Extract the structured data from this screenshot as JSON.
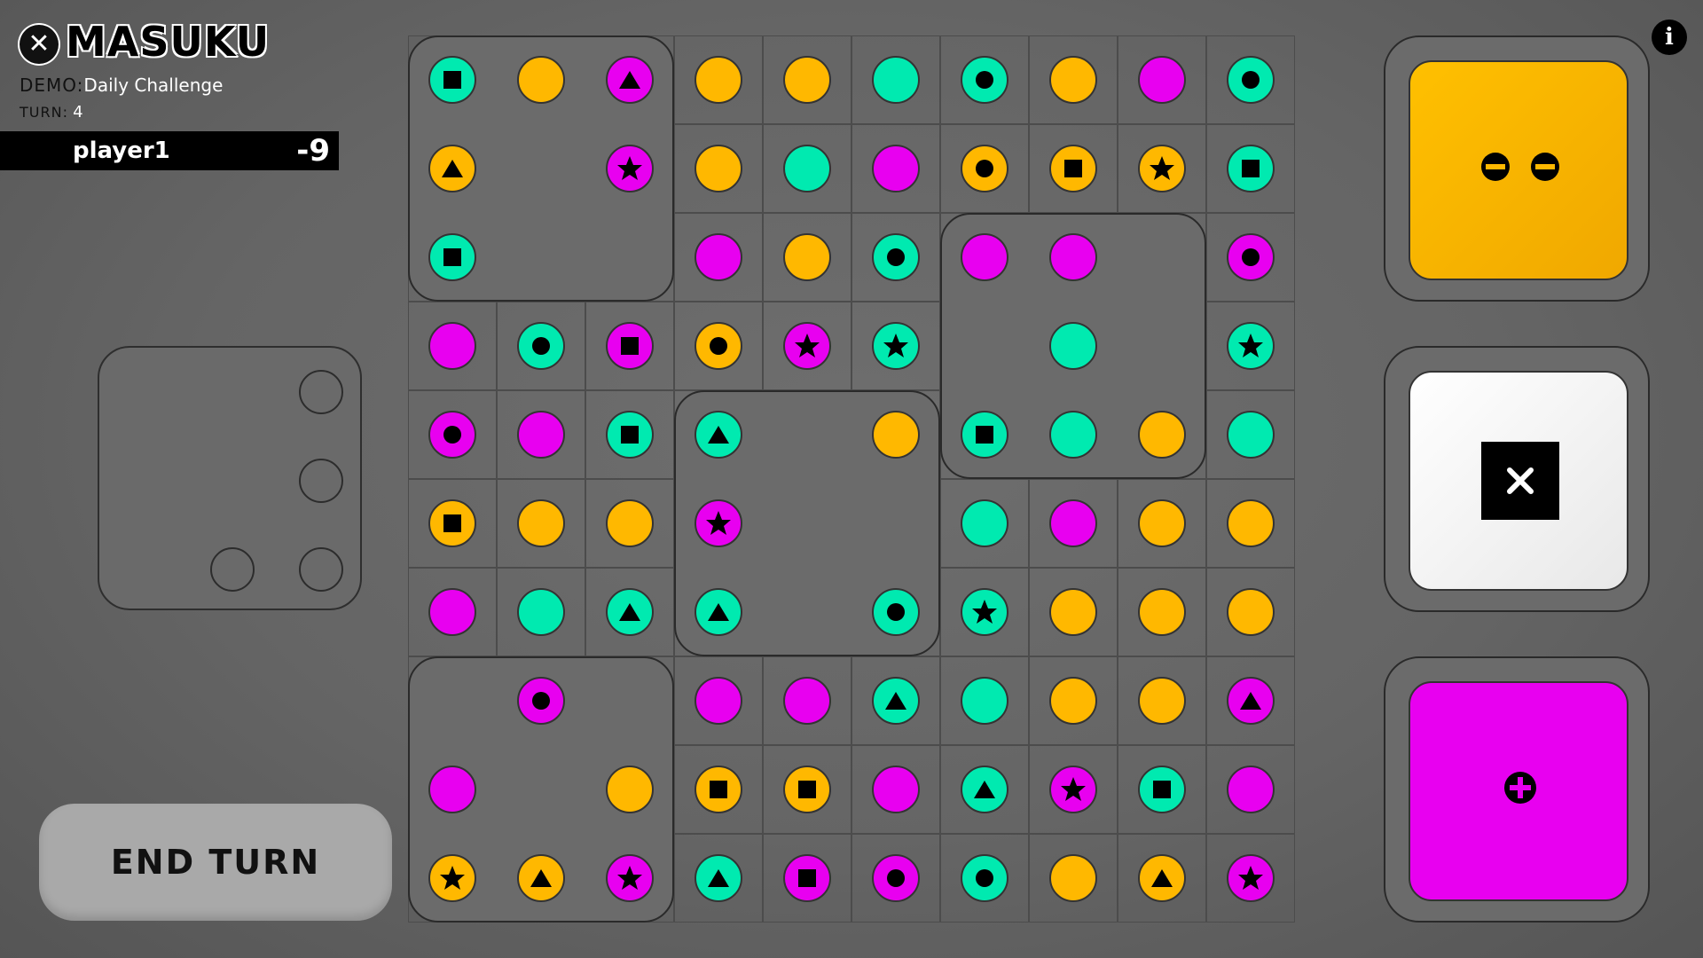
{
  "header": {
    "close_icon": "close-icon",
    "logo_text": "MASUKU",
    "mode_label": "DEMO:",
    "mode_value": "Daily Challenge",
    "turn_label": "TURN:",
    "turn_value": "4"
  },
  "player": {
    "name": "player1",
    "score": "-9"
  },
  "end_turn_label": "END TURN",
  "info_icon": "info-icon",
  "colors": {
    "orange": "#FFB800",
    "teal": "#00EAB0",
    "magenta": "#E800F0",
    "empty": "#6b6b6b"
  },
  "side_panel": {
    "pips": [
      {
        "row": 0,
        "col": 2
      },
      {
        "row": 1,
        "col": 2
      },
      {
        "row": 2,
        "col": 1
      },
      {
        "row": 2,
        "col": 2
      }
    ]
  },
  "dice": [
    {
      "color": "orange",
      "symbol": "minus-minus"
    },
    {
      "color": "white",
      "symbol": "times"
    },
    {
      "color": "magenta",
      "symbol": "plus"
    }
  ],
  "board": {
    "size": 10,
    "pieces": [
      {
        "row": 0,
        "col": 0,
        "w": 3,
        "h": 3
      },
      {
        "row": 2,
        "col": 6,
        "w": 3,
        "h": 3
      },
      {
        "row": 4,
        "col": 3,
        "w": 3,
        "h": 3
      },
      {
        "row": 7,
        "col": 0,
        "w": 3,
        "h": 3
      }
    ],
    "tokens": [
      {
        "r": 0,
        "c": 0,
        "color": "teal",
        "shape": "square"
      },
      {
        "r": 0,
        "c": 1,
        "color": "orange",
        "shape": "none"
      },
      {
        "r": 0,
        "c": 2,
        "color": "magenta",
        "shape": "triangle"
      },
      {
        "r": 0,
        "c": 3,
        "color": "orange",
        "shape": "none"
      },
      {
        "r": 0,
        "c": 4,
        "color": "orange",
        "shape": "none"
      },
      {
        "r": 0,
        "c": 5,
        "color": "teal",
        "shape": "none"
      },
      {
        "r": 0,
        "c": 6,
        "color": "teal",
        "shape": "dot"
      },
      {
        "r": 0,
        "c": 7,
        "color": "orange",
        "shape": "none"
      },
      {
        "r": 0,
        "c": 8,
        "color": "magenta",
        "shape": "none"
      },
      {
        "r": 0,
        "c": 9,
        "color": "teal",
        "shape": "dot"
      },
      {
        "r": 1,
        "c": 0,
        "color": "orange",
        "shape": "triangle"
      },
      {
        "r": 1,
        "c": 2,
        "color": "magenta",
        "shape": "star"
      },
      {
        "r": 1,
        "c": 3,
        "color": "orange",
        "shape": "none"
      },
      {
        "r": 1,
        "c": 4,
        "color": "teal",
        "shape": "none"
      },
      {
        "r": 1,
        "c": 5,
        "color": "magenta",
        "shape": "none"
      },
      {
        "r": 1,
        "c": 6,
        "color": "orange",
        "shape": "dot"
      },
      {
        "r": 1,
        "c": 7,
        "color": "orange",
        "shape": "square"
      },
      {
        "r": 1,
        "c": 8,
        "color": "orange",
        "shape": "star"
      },
      {
        "r": 1,
        "c": 9,
        "color": "teal",
        "shape": "square"
      },
      {
        "r": 2,
        "c": 0,
        "color": "teal",
        "shape": "square"
      },
      {
        "r": 2,
        "c": 3,
        "color": "magenta",
        "shape": "none"
      },
      {
        "r": 2,
        "c": 4,
        "color": "orange",
        "shape": "none"
      },
      {
        "r": 2,
        "c": 5,
        "color": "teal",
        "shape": "dot"
      },
      {
        "r": 2,
        "c": 6,
        "color": "magenta",
        "shape": "none"
      },
      {
        "r": 2,
        "c": 7,
        "color": "magenta",
        "shape": "none"
      },
      {
        "r": 2,
        "c": 9,
        "color": "magenta",
        "shape": "dot"
      },
      {
        "r": 3,
        "c": 0,
        "color": "magenta",
        "shape": "none"
      },
      {
        "r": 3,
        "c": 1,
        "color": "teal",
        "shape": "dot"
      },
      {
        "r": 3,
        "c": 2,
        "color": "magenta",
        "shape": "square"
      },
      {
        "r": 3,
        "c": 3,
        "color": "orange",
        "shape": "dot"
      },
      {
        "r": 3,
        "c": 4,
        "color": "magenta",
        "shape": "star"
      },
      {
        "r": 3,
        "c": 5,
        "color": "teal",
        "shape": "star"
      },
      {
        "r": 3,
        "c": 7,
        "color": "teal",
        "shape": "none"
      },
      {
        "r": 3,
        "c": 9,
        "color": "teal",
        "shape": "star"
      },
      {
        "r": 4,
        "c": 0,
        "color": "magenta",
        "shape": "dot"
      },
      {
        "r": 4,
        "c": 1,
        "color": "magenta",
        "shape": "none"
      },
      {
        "r": 4,
        "c": 2,
        "color": "teal",
        "shape": "square"
      },
      {
        "r": 4,
        "c": 3,
        "color": "teal",
        "shape": "triangle"
      },
      {
        "r": 4,
        "c": 5,
        "color": "orange",
        "shape": "none"
      },
      {
        "r": 4,
        "c": 6,
        "color": "teal",
        "shape": "square"
      },
      {
        "r": 4,
        "c": 7,
        "color": "teal",
        "shape": "none"
      },
      {
        "r": 4,
        "c": 8,
        "color": "orange",
        "shape": "none"
      },
      {
        "r": 4,
        "c": 9,
        "color": "teal",
        "shape": "none"
      },
      {
        "r": 5,
        "c": 0,
        "color": "orange",
        "shape": "square"
      },
      {
        "r": 5,
        "c": 1,
        "color": "orange",
        "shape": "none"
      },
      {
        "r": 5,
        "c": 2,
        "color": "orange",
        "shape": "none"
      },
      {
        "r": 5,
        "c": 3,
        "color": "magenta",
        "shape": "star"
      },
      {
        "r": 5,
        "c": 6,
        "color": "teal",
        "shape": "none"
      },
      {
        "r": 5,
        "c": 7,
        "color": "magenta",
        "shape": "none"
      },
      {
        "r": 5,
        "c": 8,
        "color": "orange",
        "shape": "none"
      },
      {
        "r": 5,
        "c": 9,
        "color": "orange",
        "shape": "none"
      },
      {
        "r": 6,
        "c": 0,
        "color": "magenta",
        "shape": "none"
      },
      {
        "r": 6,
        "c": 1,
        "color": "teal",
        "shape": "none"
      },
      {
        "r": 6,
        "c": 2,
        "color": "teal",
        "shape": "triangle"
      },
      {
        "r": 6,
        "c": 3,
        "color": "teal",
        "shape": "triangle"
      },
      {
        "r": 6,
        "c": 5,
        "color": "teal",
        "shape": "dot"
      },
      {
        "r": 6,
        "c": 6,
        "color": "teal",
        "shape": "star"
      },
      {
        "r": 6,
        "c": 7,
        "color": "orange",
        "shape": "none"
      },
      {
        "r": 6,
        "c": 8,
        "color": "orange",
        "shape": "none"
      },
      {
        "r": 6,
        "c": 9,
        "color": "orange",
        "shape": "none"
      },
      {
        "r": 7,
        "c": 1,
        "color": "magenta",
        "shape": "dot"
      },
      {
        "r": 7,
        "c": 3,
        "color": "magenta",
        "shape": "none"
      },
      {
        "r": 7,
        "c": 4,
        "color": "magenta",
        "shape": "none"
      },
      {
        "r": 7,
        "c": 5,
        "color": "teal",
        "shape": "triangle"
      },
      {
        "r": 7,
        "c": 6,
        "color": "teal",
        "shape": "none"
      },
      {
        "r": 7,
        "c": 7,
        "color": "orange",
        "shape": "none"
      },
      {
        "r": 7,
        "c": 8,
        "color": "orange",
        "shape": "none"
      },
      {
        "r": 7,
        "c": 9,
        "color": "magenta",
        "shape": "triangle"
      },
      {
        "r": 8,
        "c": 0,
        "color": "magenta",
        "shape": "none"
      },
      {
        "r": 8,
        "c": 2,
        "color": "orange",
        "shape": "none"
      },
      {
        "r": 8,
        "c": 3,
        "color": "orange",
        "shape": "square"
      },
      {
        "r": 8,
        "c": 4,
        "color": "orange",
        "shape": "square"
      },
      {
        "r": 8,
        "c": 5,
        "color": "magenta",
        "shape": "none"
      },
      {
        "r": 8,
        "c": 6,
        "color": "teal",
        "shape": "triangle"
      },
      {
        "r": 8,
        "c": 7,
        "color": "magenta",
        "shape": "star"
      },
      {
        "r": 8,
        "c": 8,
        "color": "teal",
        "shape": "square"
      },
      {
        "r": 8,
        "c": 9,
        "color": "magenta",
        "shape": "none"
      },
      {
        "r": 9,
        "c": 0,
        "color": "orange",
        "shape": "star"
      },
      {
        "r": 9,
        "c": 1,
        "color": "orange",
        "shape": "triangle"
      },
      {
        "r": 9,
        "c": 2,
        "color": "magenta",
        "shape": "star"
      },
      {
        "r": 9,
        "c": 3,
        "color": "teal",
        "shape": "triangle"
      },
      {
        "r": 9,
        "c": 4,
        "color": "magenta",
        "shape": "square"
      },
      {
        "r": 9,
        "c": 5,
        "color": "magenta",
        "shape": "dot"
      },
      {
        "r": 9,
        "c": 6,
        "color": "teal",
        "shape": "dot"
      },
      {
        "r": 9,
        "c": 7,
        "color": "orange",
        "shape": "none"
      },
      {
        "r": 9,
        "c": 8,
        "color": "orange",
        "shape": "triangle"
      },
      {
        "r": 9,
        "c": 9,
        "color": "magenta",
        "shape": "star"
      }
    ]
  }
}
